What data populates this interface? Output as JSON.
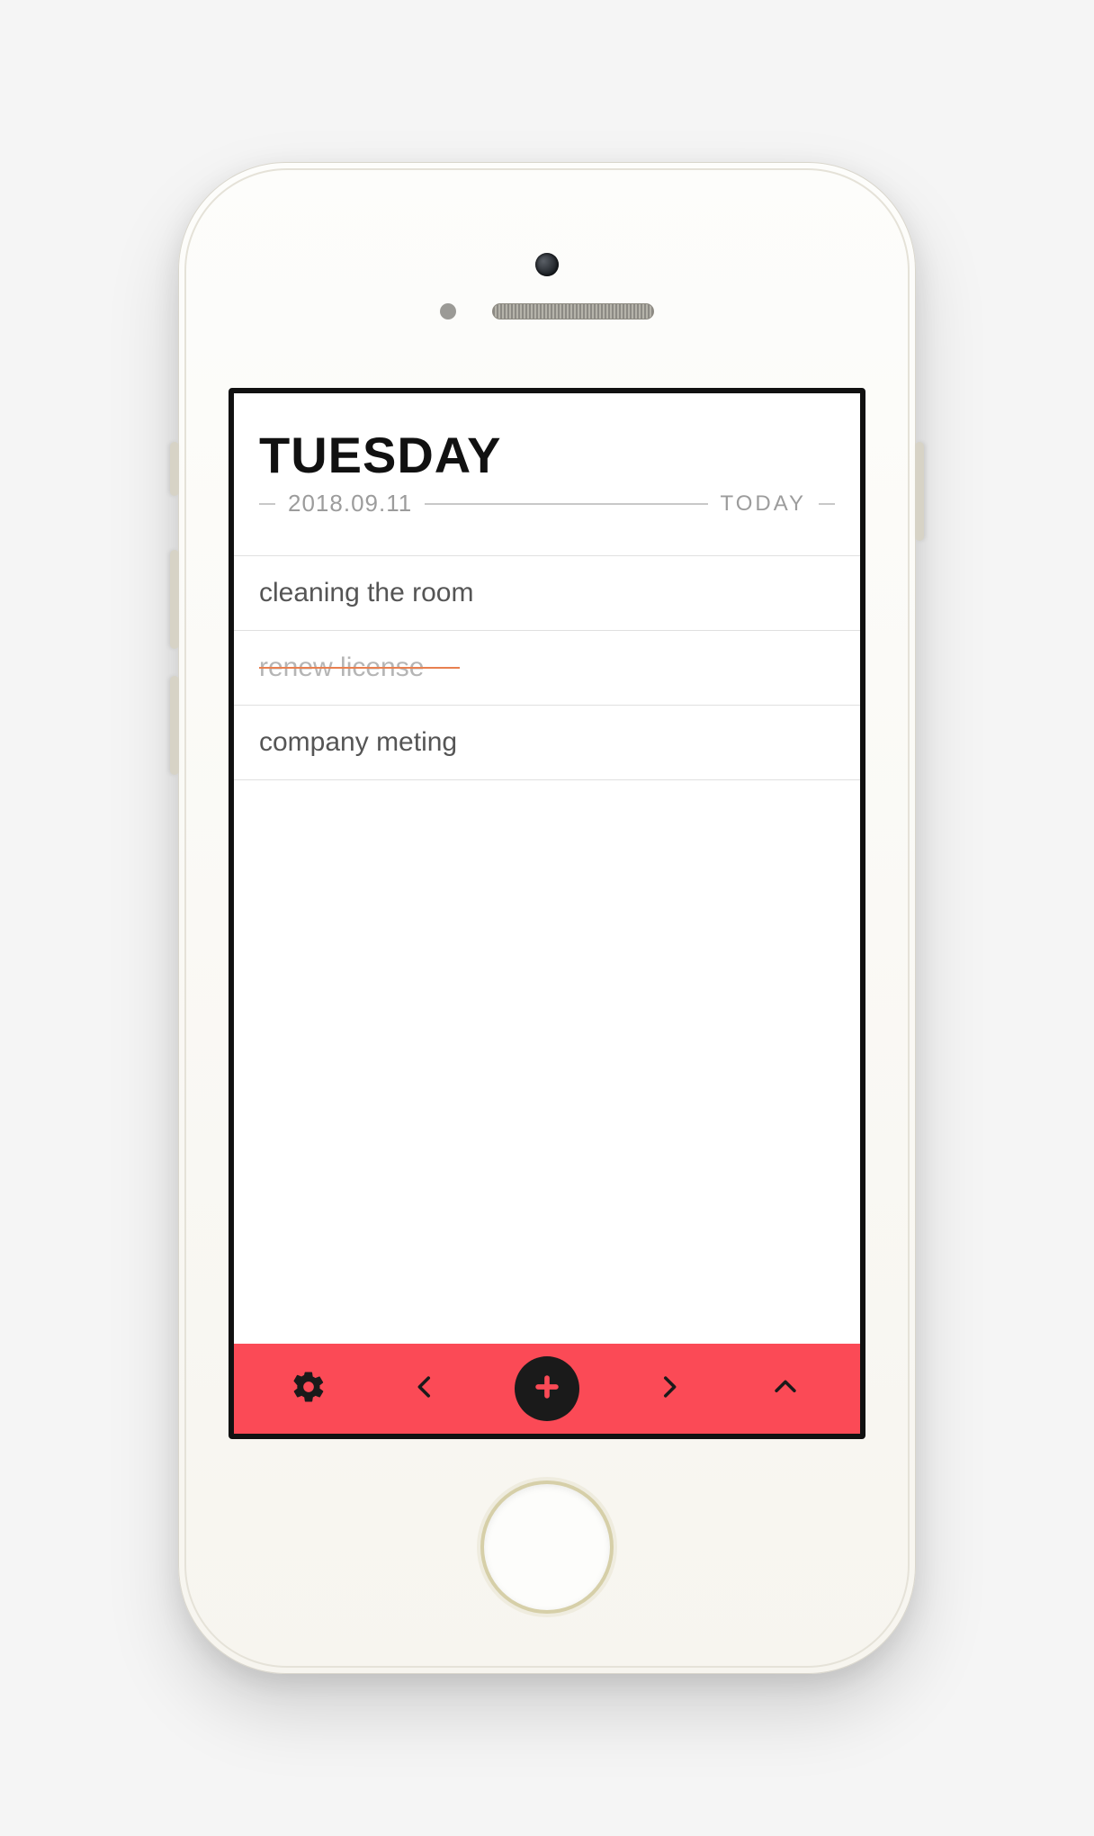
{
  "header": {
    "day_name": "TUESDAY",
    "date": "2018.09.11",
    "today_label": "TODAY"
  },
  "tasks": [
    {
      "text": "cleaning the room",
      "completed": false
    },
    {
      "text": "renew license",
      "completed": true
    },
    {
      "text": "company meting",
      "completed": false
    }
  ],
  "nav": {
    "settings": "settings",
    "prev": "previous",
    "add": "add",
    "next": "next",
    "collapse": "collapse"
  },
  "colors": {
    "accent": "#fb4a56",
    "strike": "#e88050"
  }
}
